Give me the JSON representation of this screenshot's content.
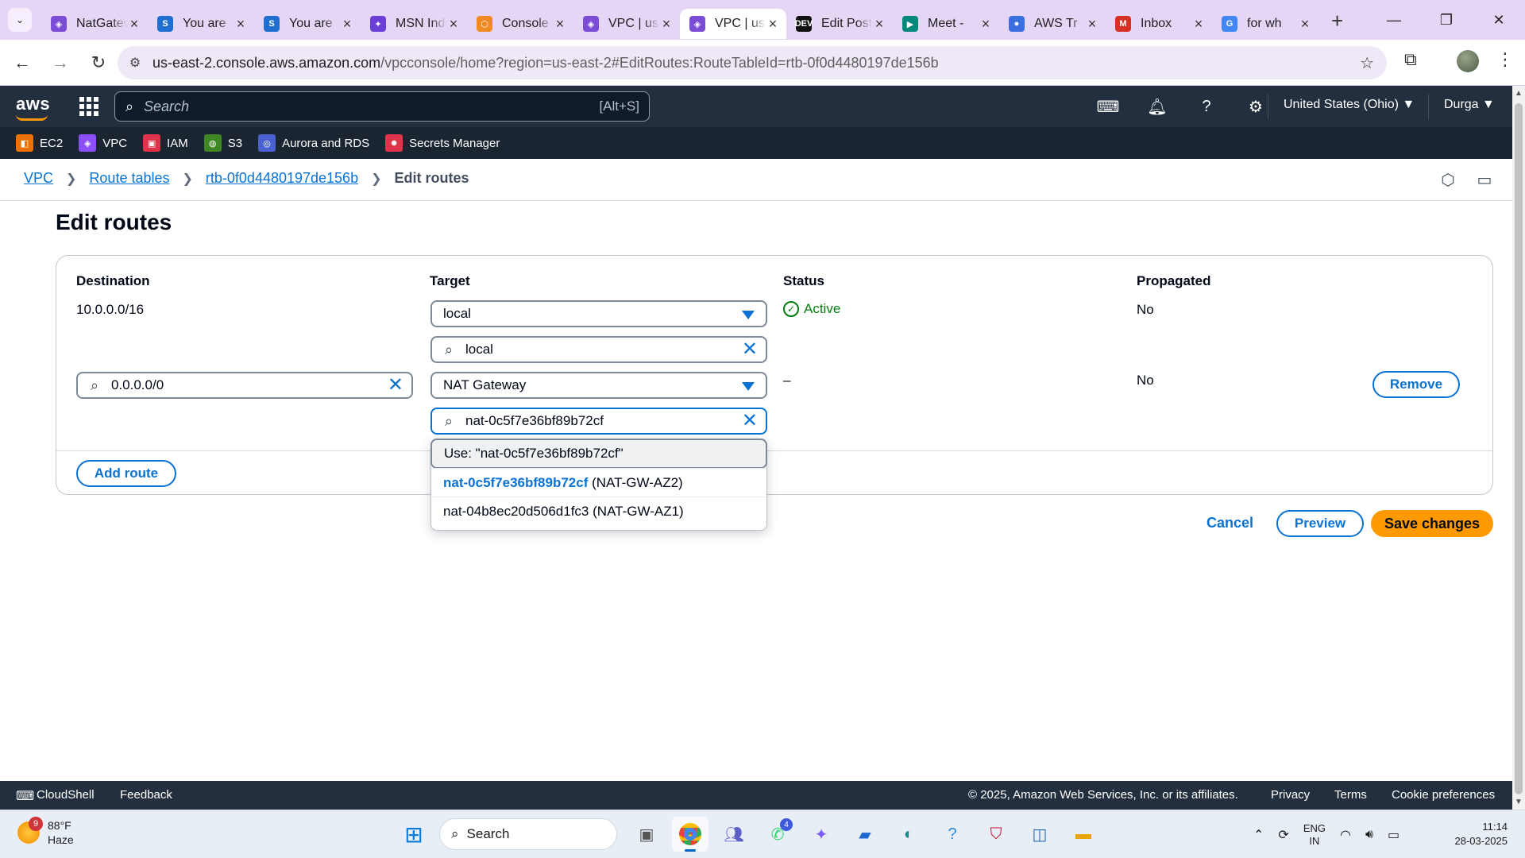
{
  "browser": {
    "tabs": [
      {
        "title": "NatGateway",
        "icon_color": "#7b4dd6",
        "icon_glyph": "◈"
      },
      {
        "title": "You are",
        "icon_color": "#1f6fd1",
        "icon_glyph": "S"
      },
      {
        "title": "You are",
        "icon_color": "#1f6fd1",
        "icon_glyph": "S"
      },
      {
        "title": "MSN India",
        "icon_color": "#6a3fd8",
        "icon_glyph": "✦"
      },
      {
        "title": "Console",
        "icon_color": "#f08a24",
        "icon_glyph": "⬡"
      },
      {
        "title": "VPC | us",
        "icon_color": "#7b4dd6",
        "icon_glyph": "◈"
      },
      {
        "title": "VPC | us",
        "icon_color": "#7b4dd6",
        "icon_glyph": "◈"
      },
      {
        "title": "Edit Post",
        "icon_color": "#111111",
        "icon_glyph": "DEV"
      },
      {
        "title": "Meet - ",
        "icon_color": "#00897b",
        "icon_glyph": "▶"
      },
      {
        "title": "AWS Tr",
        "icon_color": "#3b6fe0",
        "icon_glyph": "●"
      },
      {
        "title": "Inbox",
        "icon_color": "#d93025",
        "icon_glyph": "M"
      },
      {
        "title": "for wh",
        "icon_color": "#4285f4",
        "icon_glyph": "G"
      }
    ],
    "active_tab_index": 6,
    "url_host": "us-east-2.console.aws.amazon.com",
    "url_path": "/vpcconsole/home?region=us-east-2#EditRoutes:RouteTableId=rtb-0f0d4480197de156b"
  },
  "aws_nav": {
    "search_placeholder": "Search",
    "search_shortcut": "[Alt+S]",
    "region": "United States (Ohio) ▼",
    "user": "Durga ▼"
  },
  "favorites": [
    {
      "label": "EC2",
      "color": "#ed7100",
      "glyph": "◧"
    },
    {
      "label": "VPC",
      "color": "#8c4fff",
      "glyph": "◈"
    },
    {
      "label": "IAM",
      "color": "#dd344c",
      "glyph": "▣"
    },
    {
      "label": "S3",
      "color": "#3f8624",
      "glyph": "◍"
    },
    {
      "label": "Aurora and RDS",
      "color": "#4b61d1",
      "glyph": "◎"
    },
    {
      "label": "Secrets Manager",
      "color": "#dd344c",
      "glyph": "✹"
    }
  ],
  "breadcrumb": {
    "vpc": "VPC",
    "route_tables": "Route tables",
    "route_table_id": "rtb-0f0d4480197de156b",
    "current": "Edit routes"
  },
  "page": {
    "title": "Edit routes"
  },
  "table": {
    "headers": {
      "destination": "Destination",
      "target": "Target",
      "status": "Status",
      "propagated": "Propagated"
    },
    "row1": {
      "destination": "10.0.0.0/16",
      "target_type": "local",
      "target_search": "local",
      "status": "Active",
      "propagated": "No"
    },
    "row2": {
      "destination": "0.0.0.0/0",
      "target_type": "NAT Gateway",
      "target_search": "nat-0c5f7e36bf89b72cf",
      "status": "–",
      "propagated": "No",
      "remove_label": "Remove"
    },
    "add_route_label": "Add route"
  },
  "dropdown": {
    "use_option": "Use: \"nat-0c5f7e36bf89b72cf\"",
    "options": [
      {
        "id": "nat-0c5f7e36bf89b72cf",
        "name": "(NAT-GW-AZ2)"
      },
      {
        "id": "nat-04b8ec20d506d1fc3",
        "name": "(NAT-GW-AZ1)"
      }
    ]
  },
  "actions": {
    "cancel": "Cancel",
    "preview": "Preview",
    "save": "Save changes"
  },
  "footer": {
    "cloudshell": "CloudShell",
    "feedback": "Feedback",
    "copyright": "© 2025, Amazon Web Services, Inc. or its affiliates.",
    "privacy": "Privacy",
    "terms": "Terms",
    "cookies": "Cookie preferences"
  },
  "taskbar": {
    "temperature": "88°F",
    "weather": "Haze",
    "weather_badge": "9",
    "search_label": "Search",
    "teams_badge": "4",
    "language": "ENG",
    "region_code": "IN",
    "time": "11:14",
    "date": "28-03-2025"
  },
  "colors": {
    "aws_nav": "#232f3e",
    "link": "#0972d3",
    "primary": "#ff9900",
    "success": "#037f0c"
  }
}
